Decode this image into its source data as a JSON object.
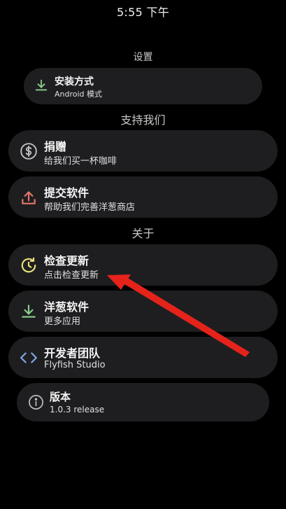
{
  "status_bar": {
    "time": "5:55 下午"
  },
  "sections": {
    "settings": "设置",
    "support": "支持我们",
    "about": "关于"
  },
  "items": {
    "install_method": {
      "title": "安装方式",
      "subtitle": "Android 模式",
      "icon": "download-icon"
    },
    "donate": {
      "title": "捐赠",
      "subtitle": "给我们买一杯咖啡",
      "icon": "dollar-circle-icon"
    },
    "submit_app": {
      "title": "提交软件",
      "subtitle": "帮助我们完善洋葱商店",
      "icon": "upload-icon"
    },
    "check_update": {
      "title": "检查更新",
      "subtitle": "点击检查更新",
      "icon": "update-clock-icon"
    },
    "onion_apps": {
      "title": "洋葱软件",
      "subtitle": "更多应用",
      "icon": "download-icon"
    },
    "developer_team": {
      "title": "开发者团队",
      "subtitle": "Flyfish Studio",
      "icon": "code-icon"
    },
    "version": {
      "title": "版本",
      "subtitle": "1.0.3 release",
      "icon": "info-icon"
    }
  },
  "colors": {
    "background": "#000000",
    "card": "#1e1e21",
    "download_icon": "#8ccf8a",
    "upload_icon": "#e8766a",
    "update_icon": "#e8e07a",
    "code_icon": "#7fa8e8",
    "neutral_icon": "#bdbdbd",
    "annotation_arrow": "#e5231b"
  }
}
